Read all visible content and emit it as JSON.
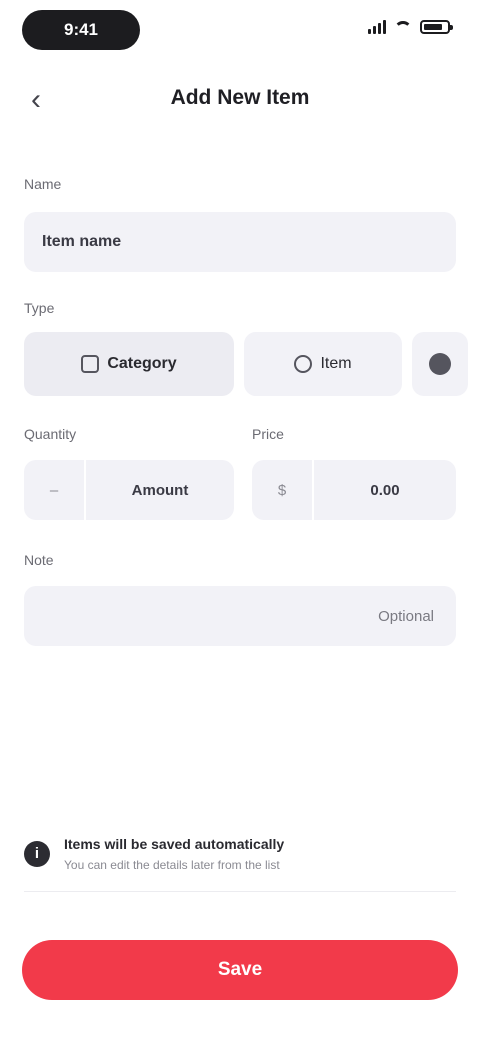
{
  "status_bar": {
    "time": "9:41"
  },
  "nav": {
    "title": "Add New Item",
    "back_glyph": "‹"
  },
  "form": {
    "name": {
      "label": "Name",
      "value": "Item name"
    },
    "type": {
      "label": "Type",
      "options": [
        {
          "label": "Category"
        },
        {
          "label": "Item"
        }
      ]
    },
    "quantity": {
      "label": "Quantity",
      "unit": "–",
      "value": "Amount"
    },
    "price": {
      "label": "Price",
      "unit": "$",
      "value": "0.00"
    },
    "note": {
      "label": "Note",
      "placeholder": "",
      "value": "Optional"
    }
  },
  "hint": {
    "icon_glyph": "i",
    "title": "Items will be saved automatically",
    "body": "You can edit the details later from the list"
  },
  "footer": {
    "note": ""
  },
  "primary_button": {
    "label": "Save"
  },
  "colors": {
    "accent": "#f23a4a",
    "field_bg": "#f2f2f7"
  }
}
